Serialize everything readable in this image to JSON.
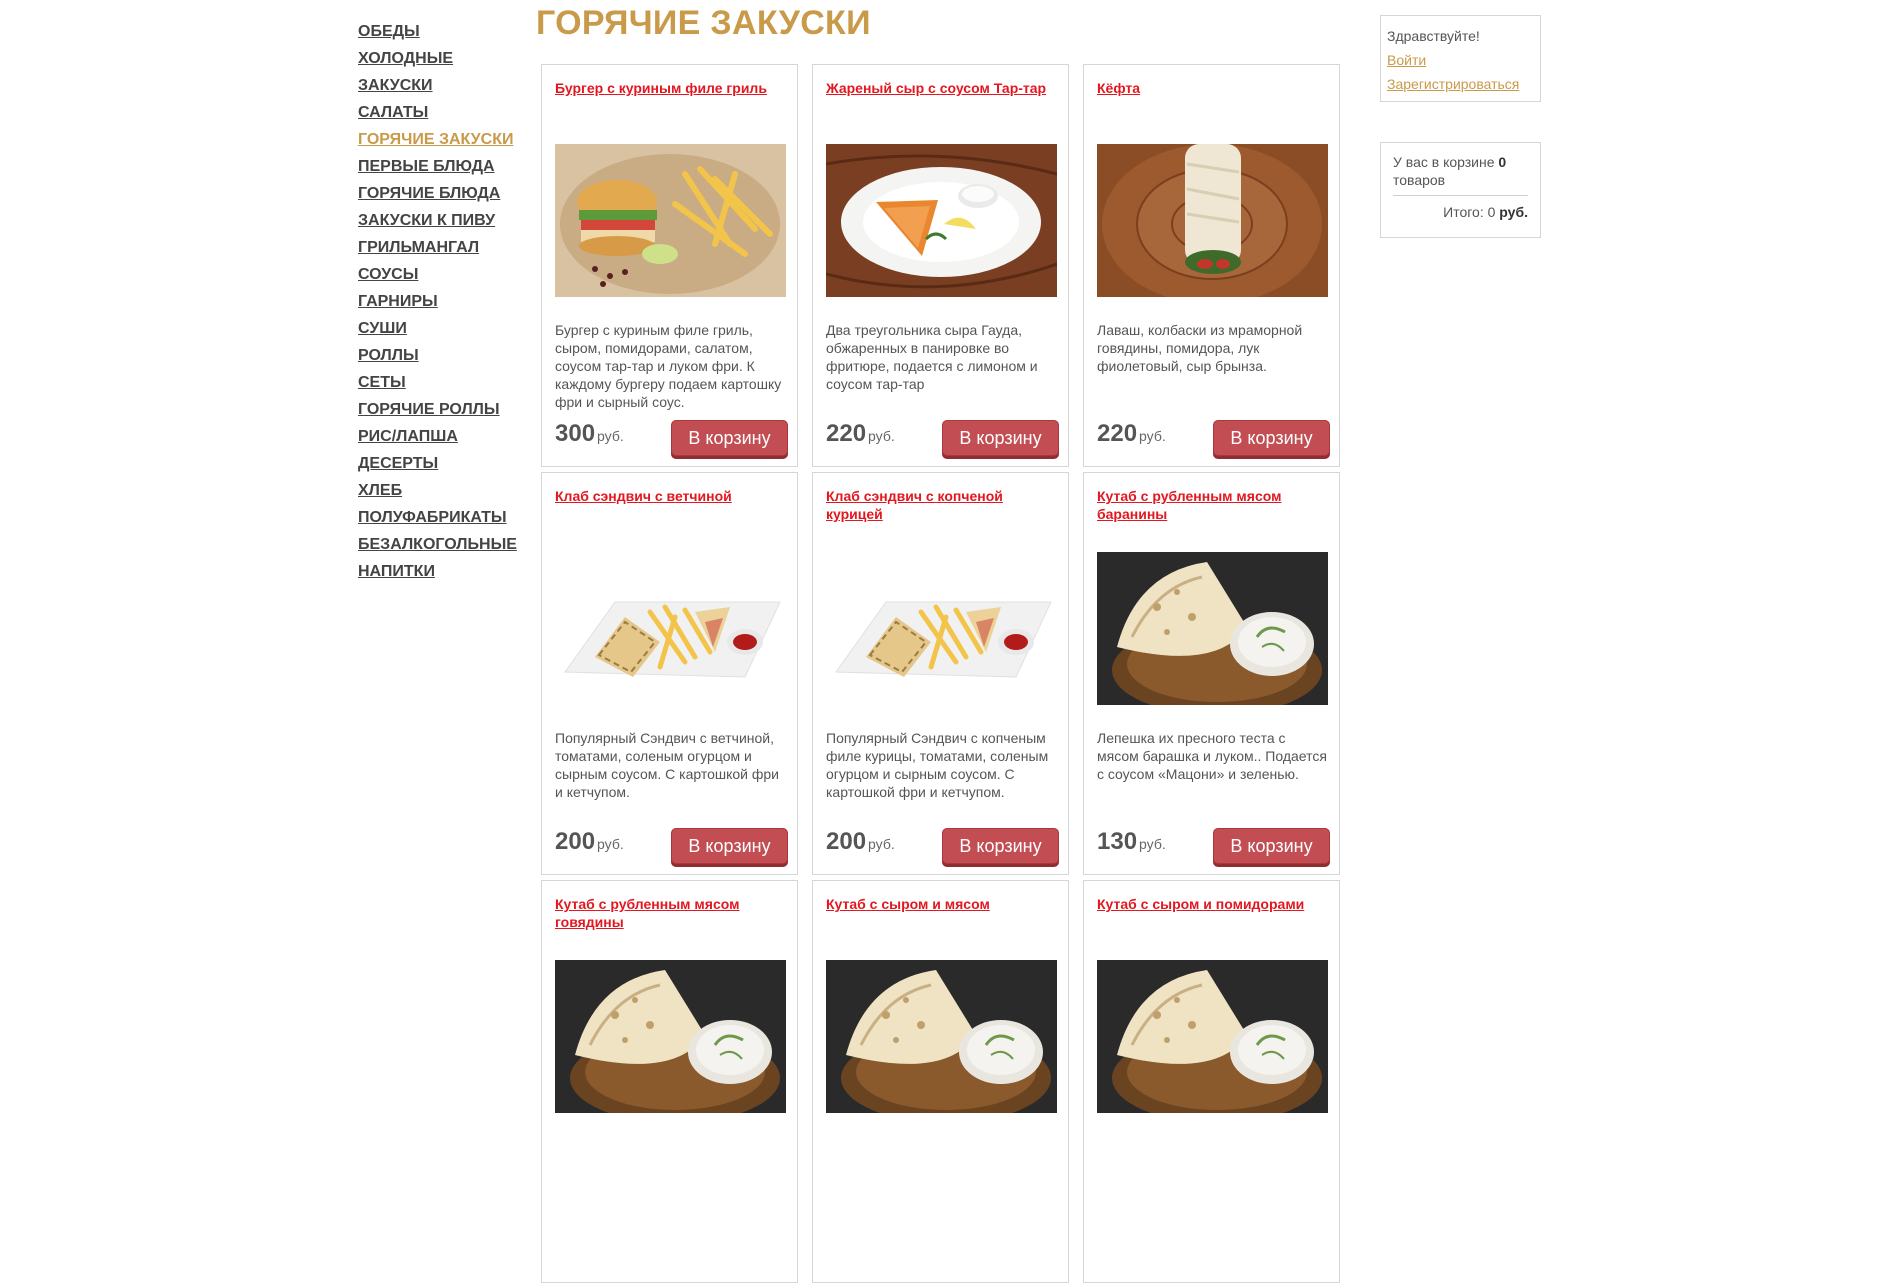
{
  "nav": {
    "items": [
      {
        "label": "ОБЕДЫ",
        "active": false
      },
      {
        "label": "ХОЛОДНЫЕ",
        "active": false
      },
      {
        "label": "ЗАКУСКИ",
        "active": false
      },
      {
        "label": "САЛАТЫ",
        "active": false
      },
      {
        "label": "ГОРЯЧИЕ ЗАКУСКИ",
        "active": true
      },
      {
        "label": "ПЕРВЫЕ БЛЮДА",
        "active": false
      },
      {
        "label": "ГОРЯЧИЕ БЛЮДА",
        "active": false
      },
      {
        "label": "ЗАКУСКИ К ПИВУ",
        "active": false
      },
      {
        "label": "ГРИЛЬМАНГАЛ",
        "active": false
      },
      {
        "label": "СОУСЫ",
        "active": false
      },
      {
        "label": "ГАРНИРЫ",
        "active": false
      },
      {
        "label": "СУШИ",
        "active": false
      },
      {
        "label": "РОЛЛЫ",
        "active": false
      },
      {
        "label": "СЕТЫ",
        "active": false
      },
      {
        "label": "ГОРЯЧИЕ РОЛЛЫ",
        "active": false
      },
      {
        "label": "РИС/ЛАПША",
        "active": false
      },
      {
        "label": "ДЕСЕРТЫ",
        "active": false
      },
      {
        "label": "ХЛЕБ",
        "active": false
      },
      {
        "label": "ПОЛУФАБРИКАТЫ",
        "active": false
      },
      {
        "label": "БЕЗАЛКОГОЛЬНЫЕ",
        "active": false
      },
      {
        "label": "НАПИТКИ",
        "active": false
      }
    ]
  },
  "page": {
    "title": "ГОРЯЧИЕ ЗАКУСКИ"
  },
  "products": [
    {
      "title": "Бургер с куриным филе гриль",
      "description": "Бургер с куриным филе гриль, сыром, помидорами, салатом, соусом тар-тар и луком фри. К каждому бургеру подаем картошку фри и сырный соус.",
      "price": "300",
      "image": "burger"
    },
    {
      "title": "Жареный сыр с соусом Тар-тар",
      "description": "Два треугольника сыра Гауда, обжаренных в панировке во фритюре, подается с лимоном и соусом тар-тар",
      "price": "220",
      "image": "fried-cheese"
    },
    {
      "title": "Кёфта",
      "description": "Лаваш, колбаски из мраморной говядины, помидора, лук фиолетовый, сыр брынза.",
      "price": "220",
      "image": "kofta-wrap"
    },
    {
      "title": "Клаб сэндвич с ветчиной",
      "description": "Популярный Сэндвич с ветчиной, томатами, соленым огурцом и сырным соусом. С картошкой фри и кетчупом.",
      "price": "200",
      "image": "club-sandwich"
    },
    {
      "title": "Клаб сэндвич с копченой курицей",
      "description": "Популярный Сэндвич с копченым филе курицы, томатами, соленым огурцом и сырным соусом. С картошкой фри и кетчупом.",
      "price": "200",
      "image": "club-sandwich"
    },
    {
      "title": "Кутаб с рубленным мясом баранины",
      "description": "Лепешка их пресного теста с мясом барашка и луком.. Подается с соусом «Мацони» и зеленью.",
      "price": "130",
      "image": "kutab"
    },
    {
      "title": "Кутаб с рубленным мясом говядины",
      "description": "",
      "price": "",
      "image": "kutab"
    },
    {
      "title": "Кутаб с сыром и мясом",
      "description": "",
      "price": "",
      "image": "kutab"
    },
    {
      "title": "Кутаб с сыром и помидорами",
      "description": "",
      "price": "",
      "image": "kutab"
    }
  ],
  "labels": {
    "currency": "руб.",
    "add_to_cart": "В корзину"
  },
  "user": {
    "greeting": "Здравствуйте!",
    "login": "Войти",
    "register": "Зарегистрироваться"
  },
  "cart": {
    "prefix": "У вас в корзине",
    "count": "0",
    "suffix": "товаров",
    "total_label": "Итого:",
    "total_value": "0",
    "total_currency": "руб."
  },
  "colors": {
    "accent": "#c99a4a",
    "link_red": "#e3171f",
    "button": "#c24d52"
  }
}
